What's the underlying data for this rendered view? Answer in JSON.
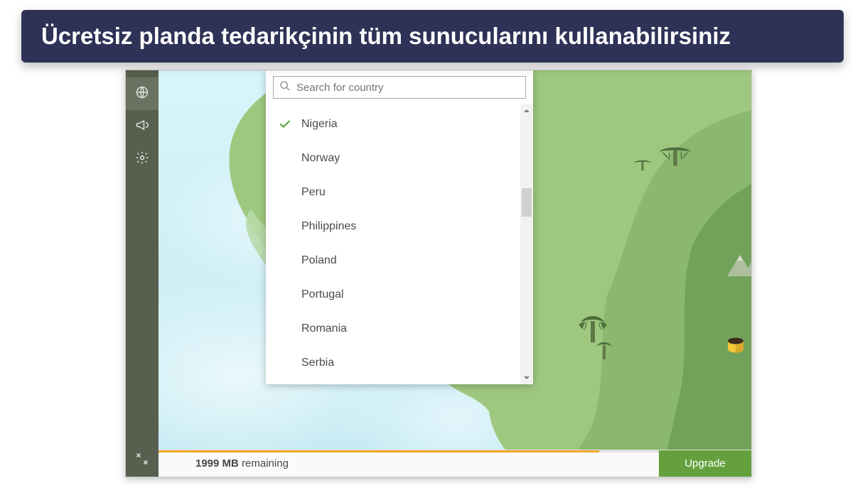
{
  "banner": {
    "text": "Ücretsiz planda tedarikçinin tüm sunucularını kullanabilirsiniz"
  },
  "sidebar": {
    "items": [
      {
        "name": "globe-icon",
        "active": true
      },
      {
        "name": "announcement-icon",
        "active": false
      },
      {
        "name": "gear-icon",
        "active": false
      }
    ],
    "footer": {
      "name": "collapse-icon"
    }
  },
  "search": {
    "placeholder": "Search for country",
    "value": ""
  },
  "countries": [
    {
      "label": "Nigeria",
      "selected": true
    },
    {
      "label": "Norway",
      "selected": false
    },
    {
      "label": "Peru",
      "selected": false
    },
    {
      "label": "Philippines",
      "selected": false
    },
    {
      "label": "Poland",
      "selected": false
    },
    {
      "label": "Portugal",
      "selected": false
    },
    {
      "label": "Romania",
      "selected": false
    },
    {
      "label": "Serbia",
      "selected": false
    }
  ],
  "bottom": {
    "data_value": "1999 MB",
    "data_suffix": "remaining",
    "upgrade_label": "Upgrade"
  },
  "colors": {
    "banner_bg": "#2e3256",
    "accent_orange": "#f1a52b",
    "accent_green": "#64a13e",
    "sidebar_bg": "#57604f",
    "land_base": "#9ec87f",
    "land_mid": "#86b66b",
    "land_dark": "#6f9f57",
    "ocean": "#d3f2f8"
  }
}
